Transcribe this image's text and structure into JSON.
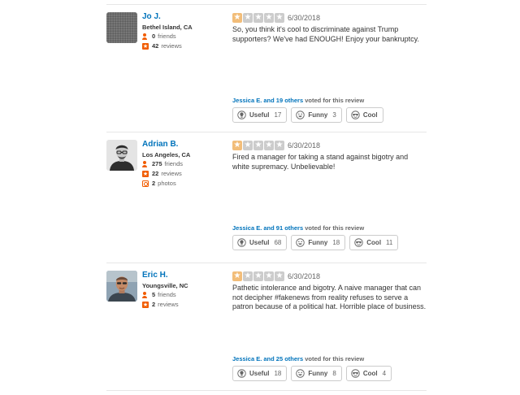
{
  "vote_suffix": "voted for this review",
  "buttons": {
    "useful": "Useful",
    "funny": "Funny",
    "cool": "Cool"
  },
  "reviews": [
    {
      "name": "Jo J.",
      "location": "Bethel Island, CA",
      "friends_count": "0",
      "friends_label": "friends",
      "reviews_count": "42",
      "reviews_label": "reviews",
      "rating": 1,
      "date": "6/30/2018",
      "text": "So, you think it's cool to discriminate against Trump supporters? We've had ENOUGH! Enjoy your bankruptcy.",
      "voters": "Jessica E. and 19 others",
      "useful": "17",
      "funny": "3",
      "cool": ""
    },
    {
      "name": "Adrian B.",
      "location": "Los Angeles, CA",
      "friends_count": "275",
      "friends_label": "friends",
      "reviews_count": "22",
      "reviews_label": "reviews",
      "photos_count": "2",
      "photos_label": "photos",
      "rating": 1,
      "date": "6/30/2018",
      "text": "Fired a manager for taking a stand against bigotry and white supremacy. Unbelievable!",
      "voters": "Jessica E. and 91 others",
      "useful": "68",
      "funny": "18",
      "cool": "11"
    },
    {
      "name": "Eric H.",
      "location": "Youngsville, NC",
      "friends_count": "5",
      "friends_label": "friends",
      "reviews_count": "2",
      "reviews_label": "reviews",
      "rating": 1,
      "date": "6/30/2018",
      "text": "Pathetic intolerance and bigotry. A naive manager that can not decipher #fakenews from reality refuses to serve a patron because of a political hat. Horrible place of business.",
      "voters": "Jessica E. and 25 others",
      "useful": "18",
      "funny": "8",
      "cool": "4"
    }
  ]
}
